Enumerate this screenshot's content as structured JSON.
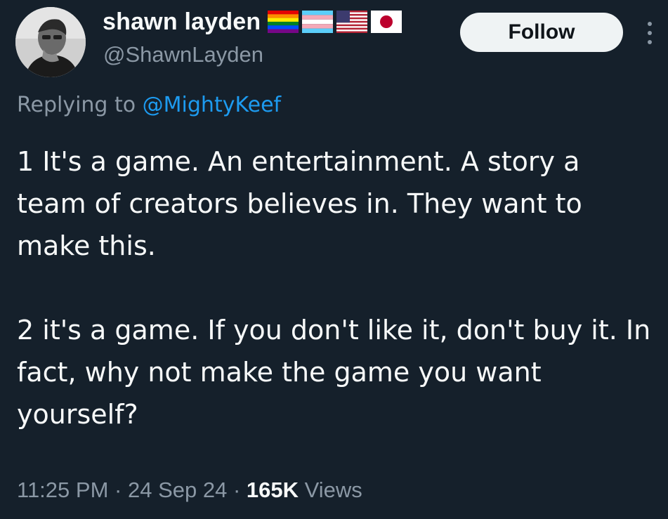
{
  "author": {
    "display_name": "shawn layden",
    "handle": "@ShawnLayden",
    "flags": [
      "rainbow-flag-icon",
      "transgender-flag-icon",
      "us-flag-icon",
      "japan-flag-icon"
    ]
  },
  "actions": {
    "follow_label": "Follow",
    "more_icon": "more-vertical-icon"
  },
  "reply": {
    "prefix": "Replying to ",
    "mention": "@MightyKeef"
  },
  "tweet": {
    "paragraphs": [
      "1 It's a game. An entertainment. A story a team of creators believes in. They want to make this.",
      "2 it's a game. If you don't like it, don't buy it. In fact, why not make the game you want yourself?"
    ]
  },
  "meta": {
    "time": "11:25 PM",
    "separator": "·",
    "date": "24 Sep 24",
    "views_count": "165K",
    "views_label": "Views"
  },
  "colors": {
    "background": "#15202b",
    "text_primary": "#f7f9f9",
    "text_secondary": "#8b98a5",
    "link": "#1d9bf0",
    "follow_bg": "#eff3f4"
  }
}
